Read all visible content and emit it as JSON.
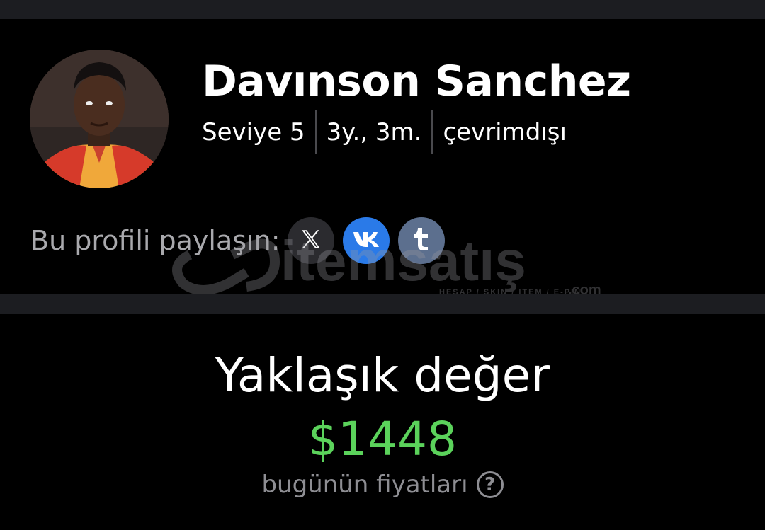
{
  "profile": {
    "name": "Davınson Sanchez",
    "level": "Seviye 5",
    "age": "3y., 3m.",
    "status": "çevrimdışı"
  },
  "share": {
    "label": "Bu profili paylaşın:",
    "buttons": [
      {
        "icon": "x-icon",
        "glyph": "𝕏",
        "color": "#2b2b2f"
      },
      {
        "icon": "vk-icon",
        "glyph": "vk",
        "color": "#2a7ae8"
      },
      {
        "icon": "tumblr-icon",
        "glyph": "t",
        "color": "#5c6f8e"
      }
    ]
  },
  "watermark": {
    "brand": "itemsatış",
    "tagline": "HESAP / SKIN / ITEM / E-PIN",
    "domain": ".com"
  },
  "value": {
    "title": "Yaklaşık değer",
    "price": "$1448",
    "note": "bugünün fiyatları",
    "help_glyph": "?"
  },
  "colors": {
    "background": "#000000",
    "panel": "#1c1d21",
    "price": "#5bd25b",
    "vk": "#2a7ae8",
    "tumblr": "#5c6f8e"
  }
}
